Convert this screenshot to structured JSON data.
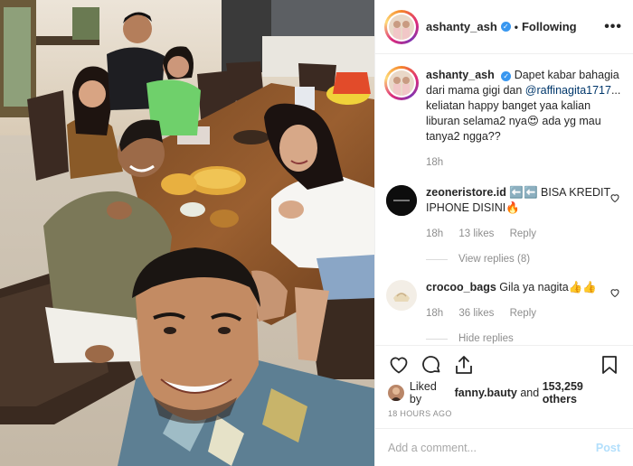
{
  "post": {
    "username": "ashanty_ash",
    "follow_status": "Following",
    "more_label": "•••"
  },
  "caption": {
    "username": "ashanty_ash",
    "text_before": "Dapet kabar bahagia dari mama gigi dan ",
    "mention": "@raffinagita1717",
    "text_after": "... keliatan happy banget yaa kalian liburan selama2 nya😍 ada yg mau tanya2 ngga??",
    "time": "18h"
  },
  "comments": [
    {
      "username": "zeoneristore.id",
      "text": "⬅️⬅️ BISA KREDIT IPHONE DISINI🔥",
      "time": "18h",
      "likes": "13 likes",
      "reply": "Reply",
      "replies_toggle": "View replies (8)"
    },
    {
      "username": "crocoo_bags",
      "text": "Gila ya nagita👍👍",
      "time": "18h",
      "likes": "36 likes",
      "reply": "Reply",
      "replies_toggle": "Hide replies"
    }
  ],
  "likes": {
    "prefix": "Liked by ",
    "user": "fanny.bauty",
    "middle": " and ",
    "count": "153,259 others"
  },
  "timestamp": "18 HOURS AGO",
  "add_comment": {
    "placeholder": "Add a comment...",
    "post_label": "Post"
  },
  "colors": {
    "verified": "#3897f0",
    "link": "#00376b",
    "post_button": "#b2dffc",
    "meta": "#8e8e8e"
  },
  "icons": [
    "heart-icon",
    "comment-icon",
    "share-icon",
    "bookmark-icon",
    "verified-badge-icon",
    "more-options-icon"
  ]
}
